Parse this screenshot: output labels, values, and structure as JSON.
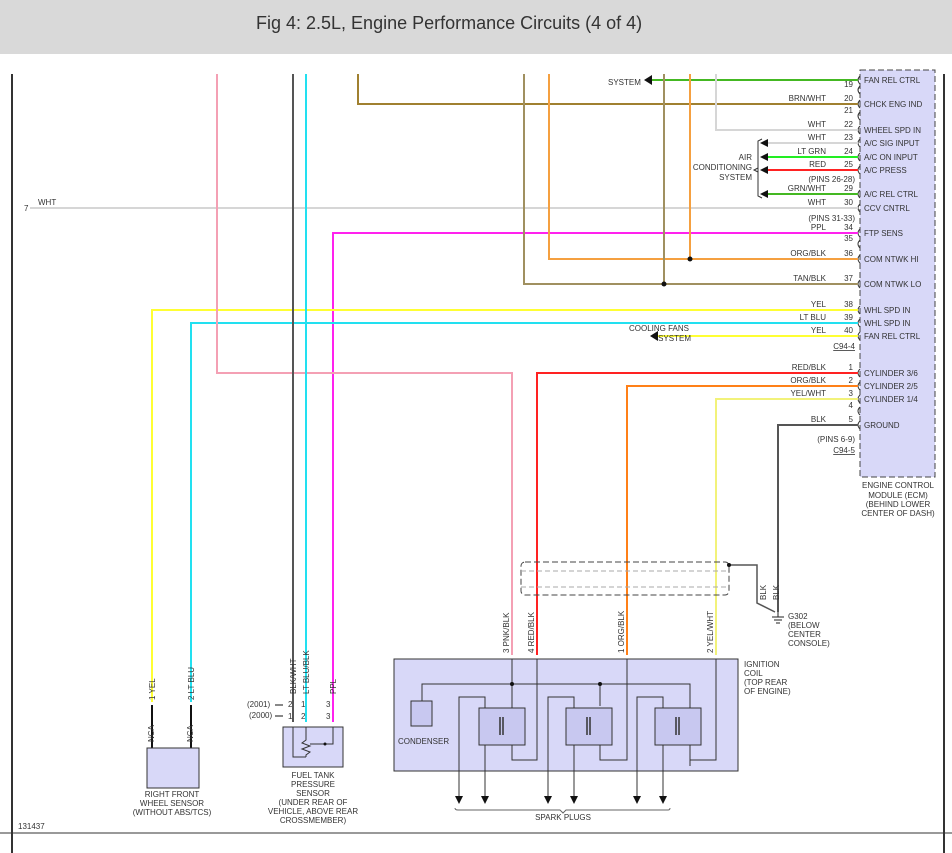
{
  "header": {
    "title": "Fig 4: 2.5L, Engine Performance Circuits (4 of 4)"
  },
  "figure_number": "131437",
  "colors": {
    "ecm_fill": "#d8d8f8",
    "pnk": "#f4a0b4",
    "blk_wht": "#555555",
    "lt_blu": "#22e0f0",
    "brn_wht": "#a08030",
    "tan_blk": "#a09060",
    "org": "#f5a040",
    "wht": "#d6d6d6",
    "grn": "#44b822",
    "lt_grn": "#22ee22",
    "red": "#ff2222",
    "ppl": "#ff22ee",
    "yel": "#ffff33",
    "org_blk": "#ff8018",
    "red_blk": "#d45050",
    "yel_wht": "#f2f27a"
  },
  "ecm": {
    "pins": [
      {
        "pin": "",
        "wire": "",
        "func": "FAN REL CTRL"
      },
      {
        "pin": "19",
        "wire": "",
        "func": ""
      },
      {
        "pin": "20",
        "wire": "BRN/WHT",
        "func": "CHCK ENG IND"
      },
      {
        "pin": "21",
        "wire": "",
        "func": ""
      },
      {
        "pin": "22",
        "wire": "WHT",
        "func": "WHEEL SPD IN"
      },
      {
        "pin": "23",
        "wire": "WHT",
        "func": "A/C SIG INPUT"
      },
      {
        "pin": "24",
        "wire": "LT GRN",
        "func": "A/C ON INPUT"
      },
      {
        "pin": "25",
        "wire": "RED",
        "func": "A/C PRESS"
      },
      {
        "pin": "(PINS 26-28)",
        "wire": "",
        "func": ""
      },
      {
        "pin": "29",
        "wire": "GRN/WHT",
        "func": "A/C REL CTRL"
      },
      {
        "pin": "30",
        "wire": "WHT",
        "func": "CCV CNTRL"
      },
      {
        "pin": "(PINS 31-33)",
        "wire": "",
        "func": ""
      },
      {
        "pin": "34",
        "wire": "PPL",
        "func": "FTP SENS"
      },
      {
        "pin": "35",
        "wire": "",
        "func": ""
      },
      {
        "pin": "36",
        "wire": "ORG/BLK",
        "func": "COM NTWK HI"
      },
      {
        "pin": "37",
        "wire": "TAN/BLK",
        "func": "COM NTWK LO"
      },
      {
        "pin": "38",
        "wire": "YEL",
        "func": "WHL SPD IN"
      },
      {
        "pin": "39",
        "wire": "LT BLU",
        "func": "WHL SPD IN"
      },
      {
        "pin": "40",
        "wire": "YEL",
        "func": "FAN REL CTRL"
      },
      {
        "pin": "C94-4",
        "wire": "",
        "func": ""
      },
      {
        "pin": "1",
        "wire": "RED/BLK",
        "func": "CYLINDER 3/6"
      },
      {
        "pin": "2",
        "wire": "ORG/BLK",
        "func": "CYLINDER 2/5"
      },
      {
        "pin": "3",
        "wire": "YEL/WHT",
        "func": "CYLINDER 1/4"
      },
      {
        "pin": "4",
        "wire": "",
        "func": ""
      },
      {
        "pin": "5",
        "wire": "BLK",
        "func": "GROUND"
      },
      {
        "pin": "(PINS 6-9)",
        "wire": "",
        "func": ""
      },
      {
        "pin": "C94-5",
        "wire": "",
        "func": ""
      }
    ],
    "label": [
      "ENGINE CONTROL",
      "MODULE (ECM)",
      "(BEHIND LOWER",
      "CENTER OF DASH)"
    ]
  },
  "systems": {
    "top_system": "SYSTEM",
    "ac": [
      "AIR",
      "CONDITIONING",
      "SYSTEM"
    ],
    "cooling": [
      "COOLING FANS",
      "SYSTEM"
    ]
  },
  "left_wire": {
    "pin": "7",
    "wire": "WHT"
  },
  "wheel_sensor": {
    "pins": [
      {
        "pin": "1",
        "wire": "YEL",
        "nca": "NCA"
      },
      {
        "pin": "2",
        "wire": "LT BLU",
        "nca": "NCA"
      }
    ],
    "label": [
      "RIGHT FRONT",
      "WHEEL SENSOR",
      "(WITHOUT ABS/TCS)"
    ]
  },
  "fuel_tank_sensor": {
    "wires": [
      "BLK/WHT",
      "LT BLU/BLK",
      "PPL"
    ],
    "pins_2001": [
      "2",
      "1",
      "3"
    ],
    "pins_2000": [
      "1",
      "2",
      "3"
    ],
    "year_2001": "(2001)",
    "year_2000": "(2000)",
    "label": [
      "FUEL TANK",
      "PRESSURE",
      "SENSOR",
      "(UNDER REAR OF",
      "VEHICLE, ABOVE REAR",
      "CROSSMEMBER)"
    ]
  },
  "ignition_coil": {
    "pins": [
      {
        "pin": "3",
        "wire": "PNK/BLK"
      },
      {
        "pin": "4",
        "wire": "RED/BLK"
      },
      {
        "pin": "1",
        "wire": "ORG/BLK"
      },
      {
        "pin": "2",
        "wire": "YEL/WHT"
      }
    ],
    "condenser": "CONDENSER",
    "label": [
      "IGNITION",
      "COIL",
      "(TOP REAR",
      "OF ENGINE)"
    ],
    "spark_plugs": "SPARK PLUGS"
  },
  "ground": {
    "wires": [
      "BLK",
      "BLK"
    ],
    "label": [
      "G302",
      "(BELOW",
      "CENTER",
      "CONSOLE)"
    ]
  }
}
